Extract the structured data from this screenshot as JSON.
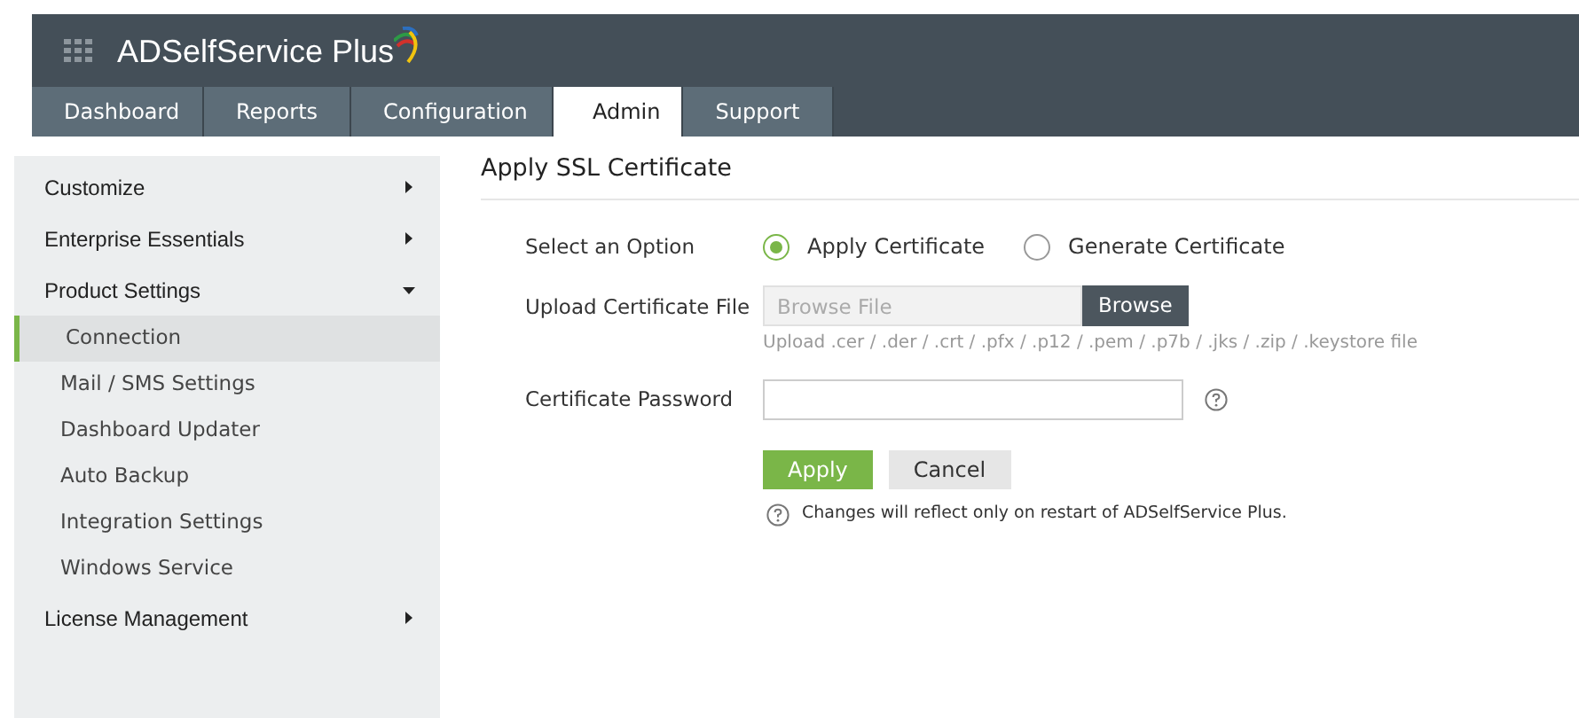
{
  "app": {
    "name": "ADSelfService Plus"
  },
  "tabs": [
    {
      "label": "Dashboard",
      "selected": false
    },
    {
      "label": "Reports",
      "selected": false
    },
    {
      "label": "Configuration",
      "selected": false
    },
    {
      "label": "Admin",
      "selected": true
    },
    {
      "label": "Support",
      "selected": false
    }
  ],
  "sidebar": {
    "items": [
      {
        "label": "Customize",
        "expanded": false
      },
      {
        "label": "Enterprise Essentials",
        "expanded": false
      },
      {
        "label": "Product Settings",
        "expanded": true,
        "children": [
          {
            "label": "Connection",
            "selected": true
          },
          {
            "label": "Mail / SMS Settings",
            "selected": false
          },
          {
            "label": "Dashboard Updater",
            "selected": false
          },
          {
            "label": "Auto Backup",
            "selected": false
          },
          {
            "label": "Integration Settings",
            "selected": false
          },
          {
            "label": "Windows Service",
            "selected": false
          }
        ]
      },
      {
        "label": "License Management",
        "expanded": false
      }
    ]
  },
  "form": {
    "title": "Apply SSL Certificate",
    "option": {
      "label": "Select an Option",
      "choices": [
        {
          "label": "Apply Certificate",
          "selected": true
        },
        {
          "label": "Generate Certificate",
          "selected": false
        }
      ]
    },
    "upload": {
      "label": "Upload Certificate File",
      "placeholder": "Browse File",
      "button": "Browse",
      "hint": "Upload .cer / .der / .crt / .pfx / .p12 / .pem / .p7b / .jks / .zip / .keystore file"
    },
    "password": {
      "label": "Certificate Password"
    },
    "buttons": [
      {
        "label": "Apply",
        "kind": "primary"
      },
      {
        "label": "Cancel",
        "kind": "secondary"
      }
    ],
    "note": "Changes will reflect only on restart of ADSelfService Plus."
  }
}
